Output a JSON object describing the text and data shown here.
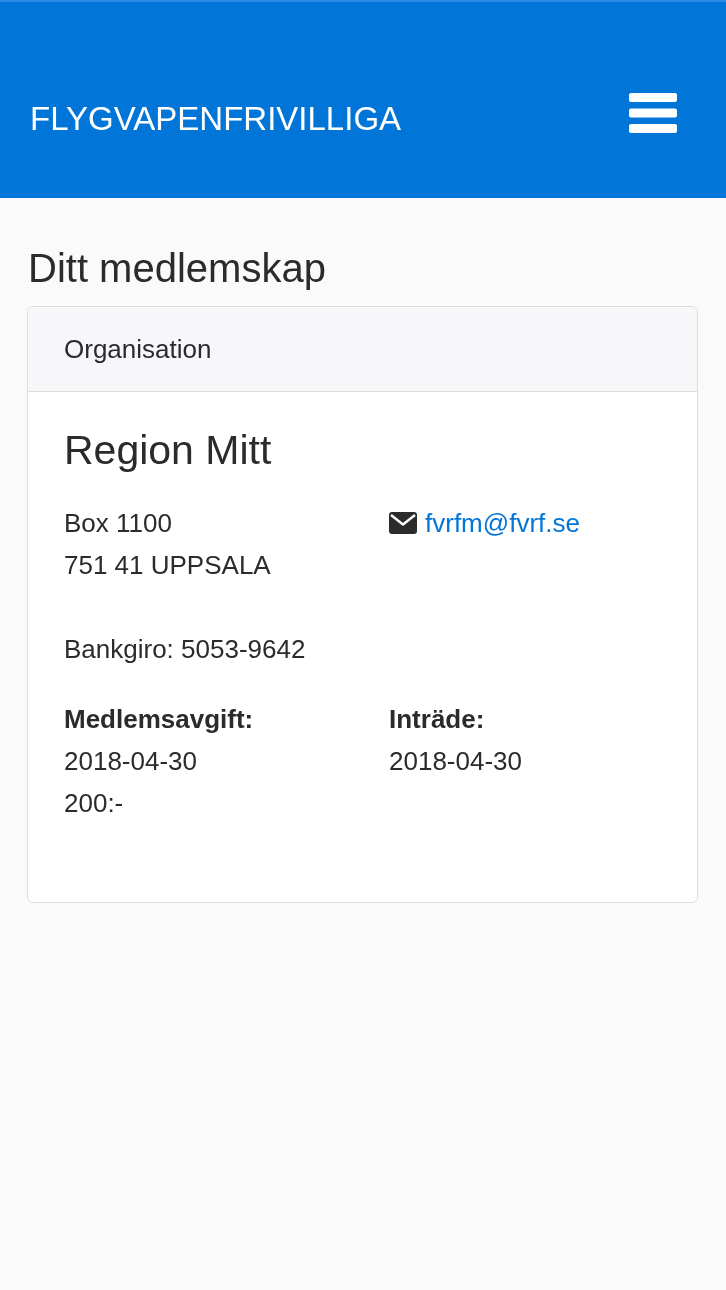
{
  "header": {
    "title": "FLYGVAPENFRIVILLIGA"
  },
  "page_title": "Ditt medlemskap",
  "card": {
    "header": "Organisation",
    "name": "Region Mitt",
    "address_lines": [
      "Box 1100",
      "751 41 UPPSALA"
    ],
    "email": "fvrfm@fvrf.se",
    "bankgiro": "Bankgiro: 5053-9642",
    "fields": [
      {
        "label": "Medlemsavgift:",
        "lines": [
          "2018-04-30",
          "200:-"
        ]
      },
      {
        "label": "Inträde:",
        "lines": [
          "2018-04-30"
        ]
      }
    ]
  }
}
